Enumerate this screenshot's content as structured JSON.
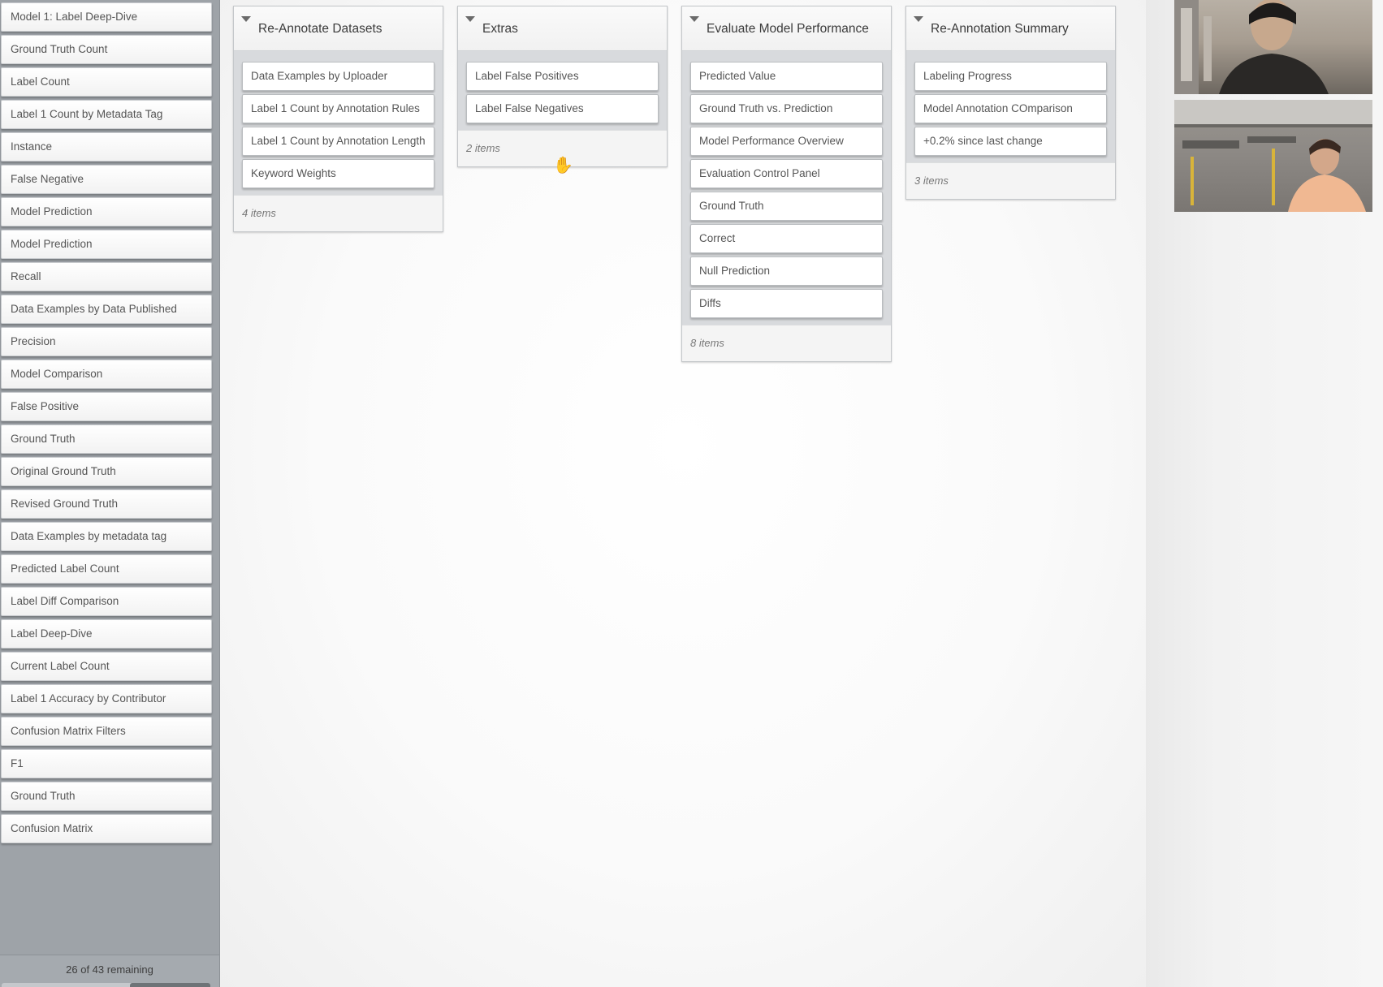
{
  "pool": {
    "items": [
      "Model 1: Label Deep-Dive",
      "Ground Truth Count",
      "Label Count",
      "Label 1 Count by Metadata Tag",
      "Instance",
      "False Negative",
      "Model Prediction",
      "Model Prediction",
      "Recall",
      "Data Examples by Data Published",
      "Precision",
      "Model Comparison",
      "False Positive",
      "Ground Truth",
      "Original Ground Truth",
      "Revised Ground Truth",
      "Data Examples by metadata tag",
      "Predicted Label Count",
      "Label Diff Comparison",
      "Label Deep-Dive",
      "Current Label Count",
      "Label 1 Accuracy by Contributor",
      "Confusion Matrix Filters",
      "F1",
      "Ground Truth",
      "Confusion Matrix"
    ],
    "remaining": "26 of 43 remaining"
  },
  "columns": [
    {
      "title": "Re-Annotate Datasets",
      "cards": [
        "Data Examples by Uploader",
        "Label 1 Count by Annotation Rules",
        "Label 1 Count by Annotation Length",
        "Keyword Weights"
      ],
      "count": "4 items"
    },
    {
      "title": "Extras",
      "cards": [
        "Label False Positives",
        "Label False Negatives"
      ],
      "count": "2 items"
    },
    {
      "title": "Evaluate Model Performance",
      "cards": [
        "Predicted Value",
        "Ground Truth vs. Prediction",
        "Model Performance Overview",
        "Evaluation Control Panel",
        "Ground Truth",
        "Correct",
        "Null Prediction",
        "Diffs"
      ],
      "count": "8 items"
    },
    {
      "title": "Re-Annotation Summary",
      "cards": [
        "Labeling Progress",
        "Model Annotation COmparison",
        "+0.2% since last change"
      ],
      "count": "3 items"
    }
  ],
  "icons": {
    "collapse": "caret-down-icon",
    "cursor": "grab-hand-icon"
  }
}
